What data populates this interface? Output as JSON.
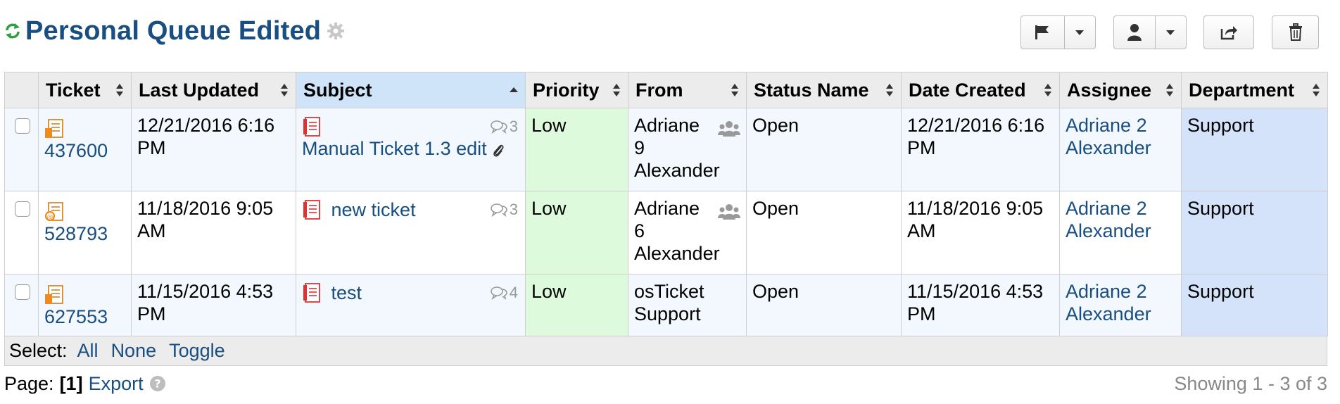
{
  "header": {
    "title": "Personal Queue Edited",
    "refresh_icon": "refresh-icon",
    "settings_icon": "gear-icon",
    "accent_color": "#184E81"
  },
  "toolbar": {
    "buttons": [
      {
        "name": "flag-button",
        "icon": "flag-icon"
      },
      {
        "name": "assign-button",
        "icon": "user-icon"
      },
      {
        "name": "transfer-button",
        "icon": "share-icon"
      },
      {
        "name": "delete-button",
        "icon": "trash-icon"
      }
    ]
  },
  "table": {
    "columns": [
      "Ticket",
      "Last Updated",
      "Subject",
      "Priority",
      "From",
      "Status Name",
      "Date Created",
      "Assignee",
      "Department"
    ],
    "sorted_column": "Subject",
    "rows": [
      {
        "ticket": "437600",
        "last_updated": "12/21/2016 6:16 PM",
        "subject": "Manual Ticket 1.3 edit",
        "threads": "3",
        "priority": "Low",
        "from": "Adriane 9 Alexander",
        "status": "Open",
        "date_created": "12/21/2016 6:16 PM",
        "assignee": "Adriane 2 Alexander",
        "department": "Support"
      },
      {
        "ticket": "528793",
        "last_updated": "11/18/2016 9:05 AM",
        "subject": "new ticket",
        "threads": "3",
        "priority": "Low",
        "from": "Adriane 6 Alexander",
        "status": "Open",
        "date_created": "11/18/2016 9:05 AM",
        "assignee": "Adriane 2 Alexander",
        "department": "Support"
      },
      {
        "ticket": "627553",
        "last_updated": "11/15/2016 4:53 PM",
        "subject": "test",
        "threads": "4",
        "priority": "Low",
        "from": "osTicket Support",
        "status": "Open",
        "date_created": "11/15/2016 4:53 PM",
        "assignee": "Adriane 2 Alexander",
        "department": "Support"
      }
    ]
  },
  "select": {
    "label": "Select:",
    "all": "All",
    "none": "None",
    "toggle": "Toggle"
  },
  "footer": {
    "page_label": "Page:",
    "page_current": "[1]",
    "export": "Export",
    "showing": "Showing 1 - 3 of 3"
  }
}
